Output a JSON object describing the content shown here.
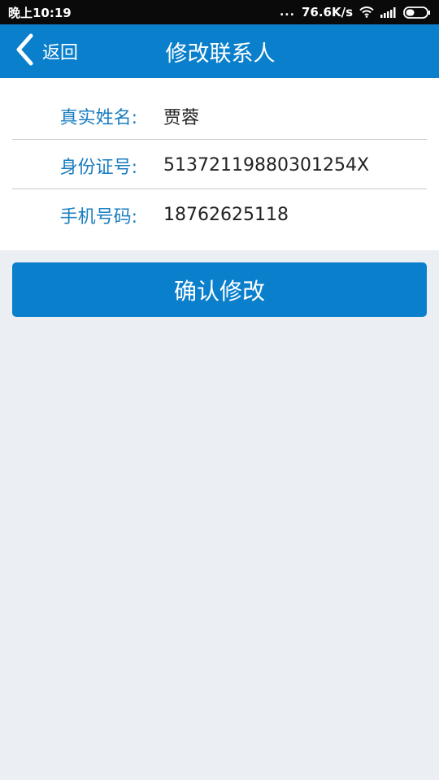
{
  "status_bar": {
    "time": "晚上10:19",
    "net_speed": "76.6K/s",
    "dots": "..."
  },
  "nav": {
    "back_label": "返回",
    "title": "修改联系人"
  },
  "form": {
    "rows": [
      {
        "label": "真实姓名:",
        "value": "贾蓉"
      },
      {
        "label": "身份证号:",
        "value": "51372119880301254X"
      },
      {
        "label": "手机号码:",
        "value": "18762625118"
      }
    ]
  },
  "confirm_button": {
    "label": "确认修改"
  },
  "colors": {
    "primary": "#0a7fcc",
    "label_text": "#1a7dc0",
    "background": "#ebeef2"
  },
  "icons": [
    "back-chevron-icon",
    "wifi-icon",
    "signal-icon",
    "battery-icon"
  ]
}
